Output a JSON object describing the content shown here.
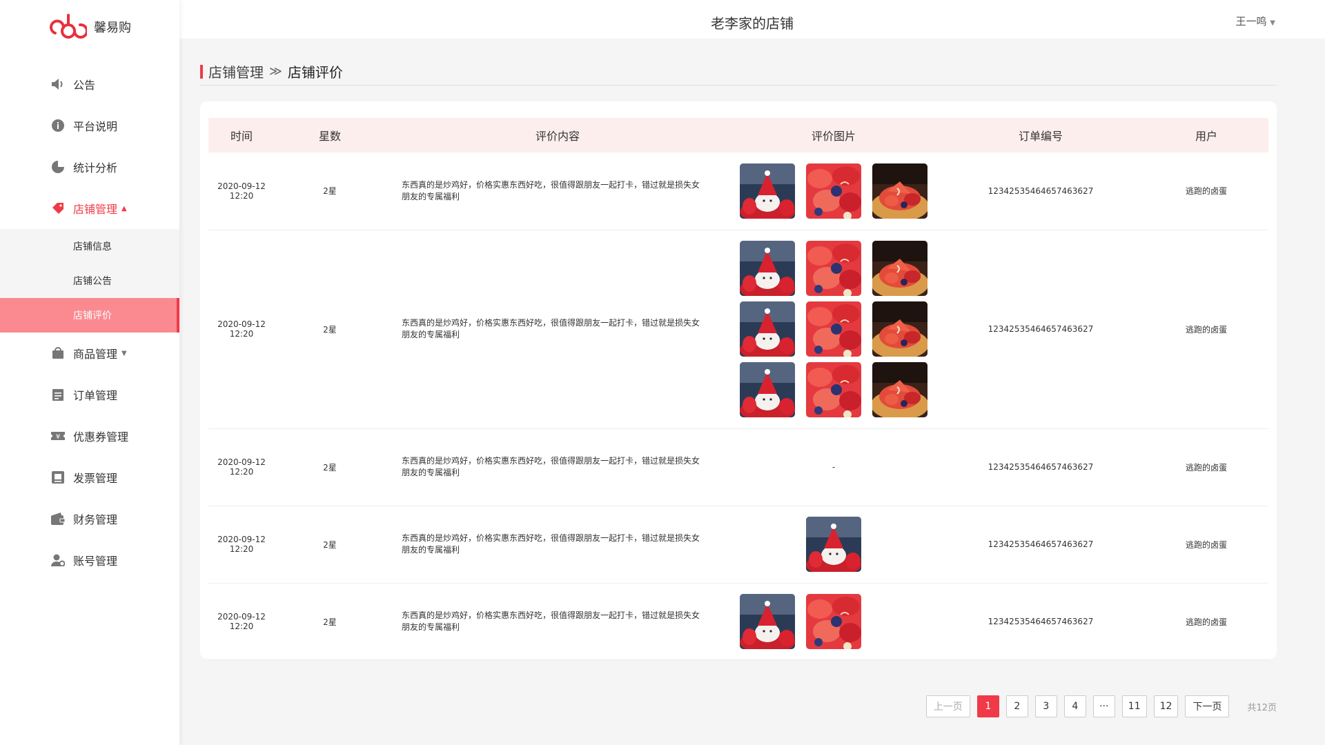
{
  "app": {
    "name": "馨易购"
  },
  "header": {
    "shop_title": "老李家的店铺",
    "user_name": "王一鸣"
  },
  "sidebar": {
    "items": [
      {
        "label": "公告",
        "icon": "speaker-icon"
      },
      {
        "label": "平台说明",
        "icon": "info-icon"
      },
      {
        "label": "统计分析",
        "icon": "pie-chart-icon"
      },
      {
        "label": "店铺管理",
        "icon": "shop-tag-icon"
      },
      {
        "label": "商品管理",
        "icon": "bag-icon"
      },
      {
        "label": "订单管理",
        "icon": "clipboard-icon"
      },
      {
        "label": "优惠券管理",
        "icon": "coupon-icon"
      },
      {
        "label": "发票管理",
        "icon": "invoice-icon"
      },
      {
        "label": "财务管理",
        "icon": "wallet-icon"
      },
      {
        "label": "账号管理",
        "icon": "user-gear-icon"
      }
    ],
    "shop_sub": [
      {
        "label": "店铺信息"
      },
      {
        "label": "店铺公告"
      },
      {
        "label": "店铺评价"
      }
    ]
  },
  "breadcrumb": {
    "parent": "店铺管理",
    "current": "店铺评价"
  },
  "table": {
    "headers": {
      "time": "时间",
      "stars": "星数",
      "content": "评价内容",
      "images": "评价图片",
      "order": "订单编号",
      "user": "用户"
    },
    "rows": [
      {
        "date": "2020-09-12",
        "time": "12:20",
        "stars": "2星",
        "content": "东西真的是炒鸡好，价格实惠东西好吃，很值得跟朋友一起打卡，错过就是损失女朋友的专属福利",
        "images": [
          "santa",
          "berries",
          "tart"
        ],
        "order": "12342535464657463627",
        "user": "逃跑的卤蛋"
      },
      {
        "date": "2020-09-12",
        "time": "12:20",
        "stars": "2星",
        "content": "东西真的是炒鸡好，价格实惠东西好吃，很值得跟朋友一起打卡，错过就是损失女朋友的专属福利",
        "images": [
          "santa",
          "berries",
          "tart",
          "santa",
          "berries",
          "tart",
          "santa",
          "berries",
          "tart"
        ],
        "order": "12342535464657463627",
        "user": "逃跑的卤蛋"
      },
      {
        "date": "2020-09-12",
        "time": "12:20",
        "stars": "2星",
        "content": "东西真的是炒鸡好，价格实惠东西好吃，很值得跟朋友一起打卡，错过就是损失女朋友的专属福利",
        "images": [],
        "no_image_text": "-",
        "order": "12342535464657463627",
        "user": "逃跑的卤蛋"
      },
      {
        "date": "2020-09-12",
        "time": "12:20",
        "stars": "2星",
        "content": "东西真的是炒鸡好，价格实惠东西好吃，很值得跟朋友一起打卡，错过就是损失女朋友的专属福利",
        "images": [
          "santa"
        ],
        "order": "12342535464657463627",
        "user": "逃跑的卤蛋"
      },
      {
        "date": "2020-09-12",
        "time": "12:20",
        "stars": "2星",
        "content": "东西真的是炒鸡好，价格实惠东西好吃，很值得跟朋友一起打卡，错过就是损失女朋友的专属福利",
        "images": [
          "santa",
          "berries"
        ],
        "order": "12342535464657463627",
        "user": "逃跑的卤蛋"
      }
    ]
  },
  "pagination": {
    "prev_label": "上一页",
    "next_label": "下一页",
    "pages": [
      "1",
      "2",
      "3",
      "4",
      "···",
      "11",
      "12"
    ],
    "current_page": "1",
    "total_text": "共12页"
  },
  "colors": {
    "accent": "#f03a47",
    "active_bg": "#fa8a90",
    "header_bg": "#fdeeee"
  }
}
